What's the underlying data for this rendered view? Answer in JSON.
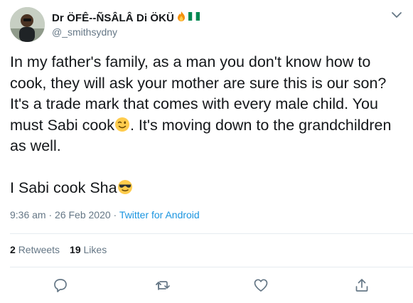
{
  "tweet": {
    "author": {
      "display_name": "Dr ÖFÊ--ÑSÂLÂ Di ÖKÜ",
      "handle": "@_smithsydny"
    },
    "text": {
      "line1": "In my father's family, as a man you don't know how to cook, they will ask your mother are sure this is our son? It's a trade mark that comes with every male child. You must Sabi cook",
      "line1_tail": ". It's moving down to the grandchildren as well.",
      "line2": "I Sabi cook Sha"
    },
    "meta": {
      "time": "9:36 am",
      "separator1": " · ",
      "date": "26 Feb 2020",
      "separator2": " · ",
      "source": "Twitter for Android"
    },
    "stats": {
      "retweets_count": "2",
      "retweets_label": "Retweets",
      "likes_count": "19",
      "likes_label": "Likes"
    },
    "icons": {
      "reply": "reply-icon",
      "retweet": "retweet-icon",
      "like": "heart-icon",
      "share": "share-icon",
      "more": "chevron-down-icon"
    },
    "colors": {
      "text": "#14171a",
      "secondary": "#657786",
      "link": "#1b95e0",
      "divider": "#e6ecf0"
    }
  }
}
